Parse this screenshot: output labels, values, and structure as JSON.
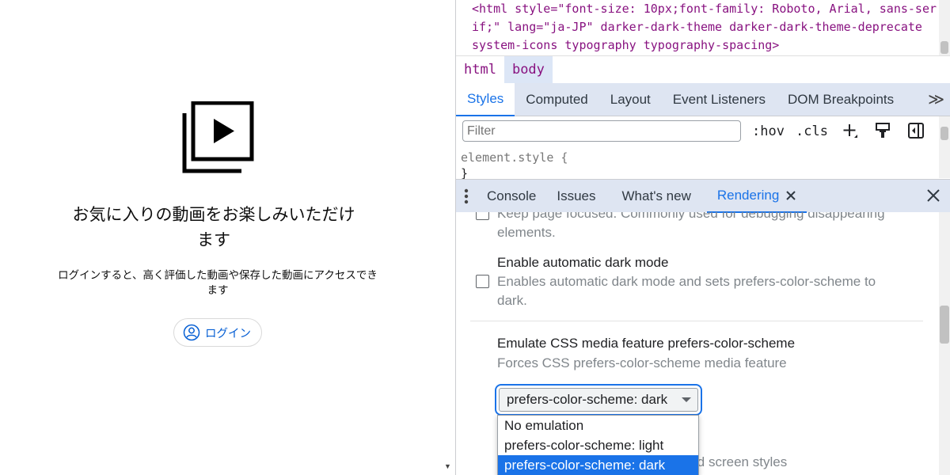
{
  "left_page": {
    "icon": "library-icon",
    "title_line1": "お気に入りの動画をお楽しみいただけ",
    "title_line2": "ます",
    "desc_line1": "ログインすると、高く評価した動画や保存した動画にアクセスでき",
    "desc_line2": "ます",
    "login_label": "ログイン",
    "login_icon": "account-circle-icon",
    "link_color": "#065fd4"
  },
  "devtools": {
    "html_source": {
      "line1": "<html style=\"font-size: 10px;font-family: Roboto, Arial, sans-ser",
      "line2": "if;\" lang=\"ja-JP\" darker-dark-theme darker-dark-theme-deprecate",
      "line3": "system-icons typography typography-spacing>"
    },
    "breadcrumbs": [
      "html",
      "body"
    ],
    "styles_tabs": [
      "Styles",
      "Computed",
      "Layout",
      "Event Listeners",
      "DOM Breakpoints"
    ],
    "styles_more": "≫",
    "filter_placeholder": "Filter",
    "hov": ":hov",
    "cls": ".cls",
    "element_style_selector": "element.style {",
    "element_style_close": "}",
    "drawer_tabs": [
      "Console",
      "Issues",
      "What's new",
      "Rendering"
    ],
    "rendering": {
      "keep_focused_desc_1": "Keep page focused. Commonly used for debugging disappearing",
      "keep_focused_desc_2": "elements.",
      "auto_dark_title": "Enable automatic dark mode",
      "auto_dark_desc_1": "Enables automatic dark mode and sets prefers-color-scheme to",
      "auto_dark_desc_2": "dark.",
      "emulate_title": "Emulate CSS media feature prefers-color-scheme",
      "emulate_desc": "Forces CSS prefers-color-scheme media feature",
      "select_value": "prefers-color-scheme: dark",
      "options": [
        "No emulation",
        "prefers-color-scheme: light",
        "prefers-color-scheme: dark"
      ],
      "selected_option": "prefers-color-scheme: dark",
      "behind_text": "nt and screen styles"
    },
    "accent_color": "#1a73e8"
  }
}
